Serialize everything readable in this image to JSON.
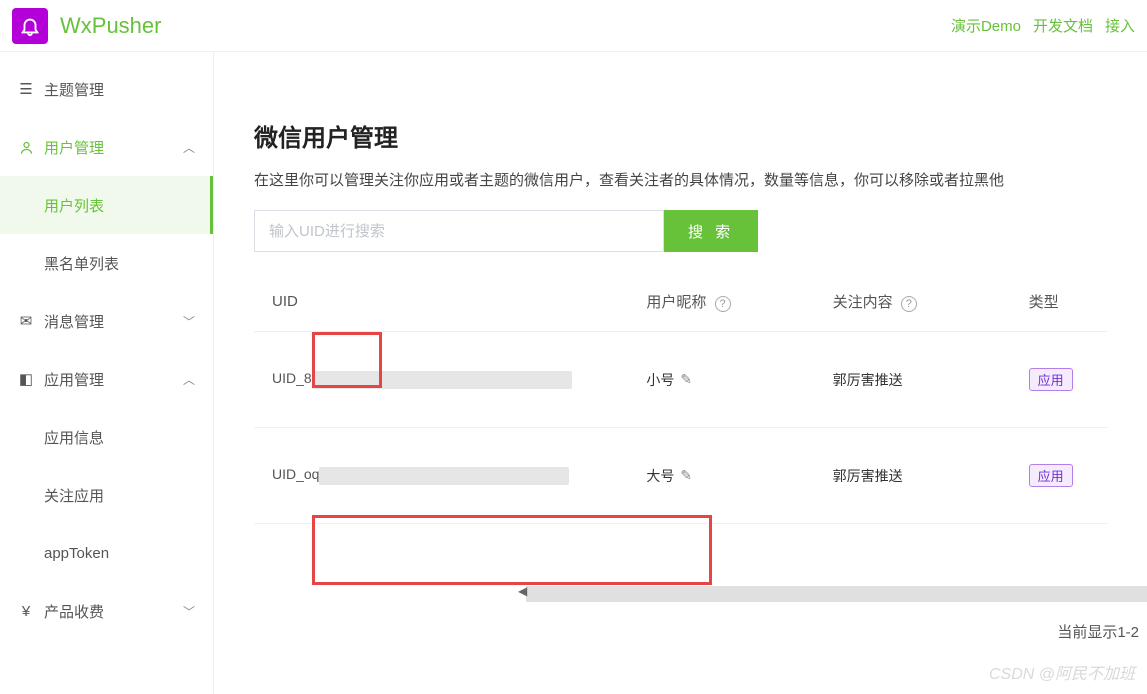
{
  "header": {
    "brand": "WxPusher",
    "links": [
      "演示Demo",
      "开发文档",
      "接入"
    ]
  },
  "sidebar": {
    "items": [
      {
        "label": "主题管理",
        "type": "leaf"
      },
      {
        "label": "用户管理",
        "type": "group",
        "expanded": true,
        "active": true
      },
      {
        "label": "用户列表",
        "type": "sub",
        "active": true
      },
      {
        "label": "黑名单列表",
        "type": "sub"
      },
      {
        "label": "消息管理",
        "type": "group",
        "expanded": false
      },
      {
        "label": "应用管理",
        "type": "group",
        "expanded": true
      },
      {
        "label": "应用信息",
        "type": "sub"
      },
      {
        "label": "关注应用",
        "type": "sub"
      },
      {
        "label": "appToken",
        "type": "sub"
      },
      {
        "label": "产品收费",
        "type": "group",
        "expanded": false
      }
    ]
  },
  "page": {
    "title": "微信用户管理",
    "desc": "在这里你可以管理关注你应用或者主题的微信用户，查看关注者的具体情况，数量等信息，你可以移除或者拉黑他",
    "search_placeholder": "输入UID进行搜索",
    "search_btn": "搜 索",
    "columns": {
      "uid": "UID",
      "nickname": "用户昵称",
      "follow": "关注内容",
      "type": "类型"
    },
    "rows": [
      {
        "uid_prefix": "UID_8",
        "nickname": "小号",
        "follow": "郭厉害推送",
        "type_badge": "应用"
      },
      {
        "uid_prefix": "UID_oq",
        "nickname": "大号",
        "follow": "郭厉害推送",
        "type_badge": "应用"
      }
    ],
    "pager": "当前显示1-2"
  },
  "watermark": "CSDN @阿民不加班"
}
